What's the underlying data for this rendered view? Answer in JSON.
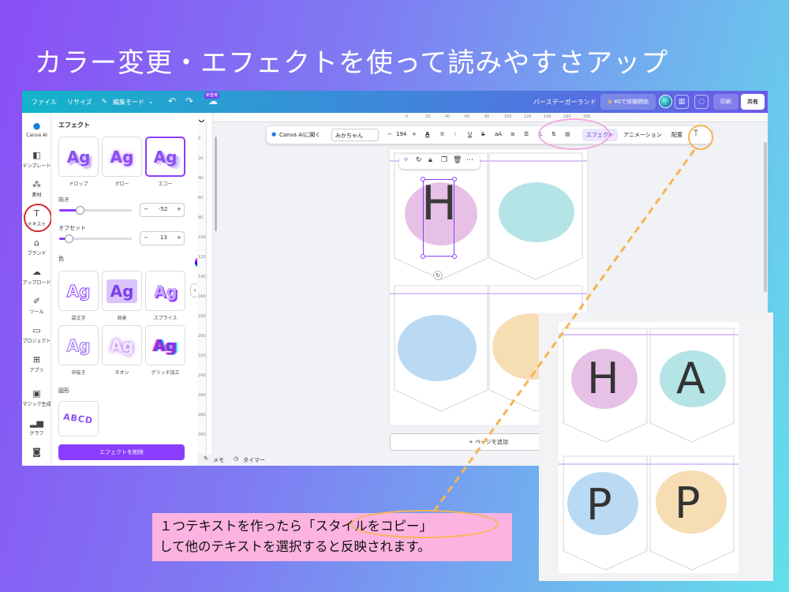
{
  "heading": "カラー変更・エフェクトを使って読みやすさアップ",
  "topbar": {
    "file": "ファイル",
    "resize": "リサイズ",
    "edit_mode": "編集モード",
    "new_badge": "新登場",
    "doc_title": "バースデーガーランド",
    "trial": "¥0で体験開始",
    "print": "印刷",
    "share": "共有"
  },
  "rail": [
    {
      "label": "Canva AI",
      "icon": "canva-ai-icon"
    },
    {
      "label": "テンプレート",
      "icon": "template-icon"
    },
    {
      "label": "素材",
      "icon": "elements-icon"
    },
    {
      "label": "テキスト",
      "icon": "text-icon"
    },
    {
      "label": "ブランド",
      "icon": "brand-icon"
    },
    {
      "label": "アップロード",
      "icon": "upload-icon"
    },
    {
      "label": "ツール",
      "icon": "tools-icon"
    },
    {
      "label": "プロジェクト",
      "icon": "project-icon"
    },
    {
      "label": "アプリ",
      "icon": "apps-icon"
    },
    {
      "label": "マジック生成",
      "icon": "magic-icon"
    },
    {
      "label": "グラフ",
      "icon": "chart-icon"
    }
  ],
  "panel": {
    "title": "エフェクト",
    "sample": "Ag",
    "shadows": [
      "ドロップ",
      "グロー",
      "エコー"
    ],
    "direction_label": "向き",
    "direction_value": "-52",
    "direction_level": 0.28,
    "offset_label": "オフセット",
    "offset_value": "13",
    "offset_level": 0.13,
    "color_label": "色",
    "styles": [
      "袋文字",
      "背景",
      "スプライス",
      "中抜き",
      "ネオン",
      "グリッチ加工"
    ],
    "shape_label": "図形",
    "curve_text": "ABCD",
    "delete_button": "エフェクトを削除"
  },
  "ruler_top": [
    "0",
    "20",
    "40",
    "60",
    "80",
    "100",
    "120",
    "140",
    "160",
    "180"
  ],
  "ruler_left": [
    "0",
    "20",
    "40",
    "60",
    "80",
    "100",
    "120",
    "140",
    "160",
    "180",
    "200",
    "220",
    "240",
    "260",
    "280",
    "300"
  ],
  "toolbar": {
    "ask_ai": "Canva AIに聞く",
    "font": "みかちゃん",
    "minus": "−",
    "size": "194",
    "plus": "+",
    "case": "aA",
    "effects": "エフェクト",
    "animate": "アニメーション",
    "position": "配置"
  },
  "canvas": {
    "letters": [
      "H",
      "A",
      "P",
      "P"
    ],
    "add_page": "+ ページを追加",
    "memo": "メモ",
    "timer": "タイマー"
  },
  "caption": {
    "line1": "１つテキストを作ったら「スタイルをコピー」",
    "line2": "して他のテキストを選択すると反映されます。"
  },
  "colors": {
    "accent": "#8b3dff",
    "pink_blot": "#e2b6e0",
    "teal_blot": "#a8dfe3",
    "blue_blot": "#aed3f1",
    "orange_blot": "#f6d7a6",
    "highlight_orange": "#f7b452",
    "highlight_pink": "#f4a9e1"
  }
}
